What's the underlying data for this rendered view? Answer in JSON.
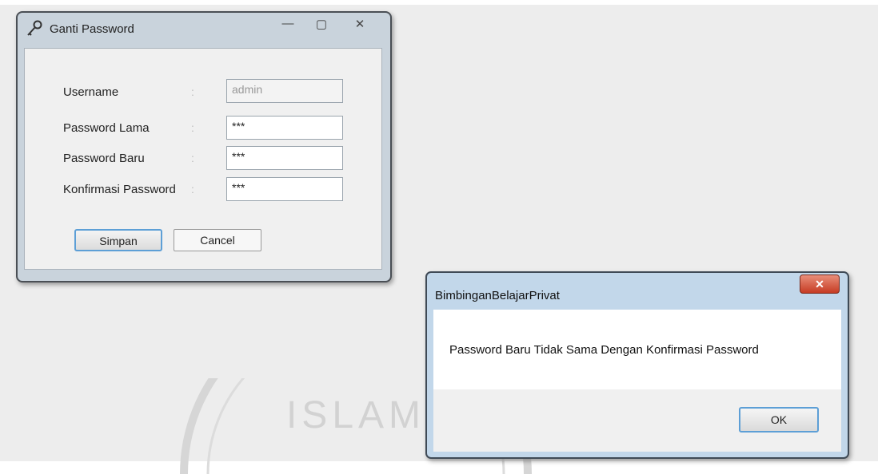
{
  "ganti_password_window": {
    "title": "Ganti Password",
    "controls": {
      "minimize": "—",
      "maximize": "▢",
      "close": "✕"
    },
    "form": {
      "username_label": "Username",
      "username_value": "admin",
      "old_password_label": "Password Lama",
      "old_password_value": "***",
      "new_password_label": "Password Baru",
      "new_password_value": "***",
      "confirm_password_label": "Konfirmasi Password",
      "confirm_password_value": "***",
      "colon": ":"
    },
    "buttons": {
      "save": "Simpan",
      "cancel": "Cancel"
    }
  },
  "message_box": {
    "title": "BimbinganBelajarPrivat",
    "close": "✕",
    "message": "Password Baru Tidak Sama Dengan Konfirmasi Password",
    "ok": "OK"
  },
  "watermark": {
    "text": "ISLAM"
  },
  "colors": {
    "background": "#ededed",
    "window_frame": "#c9d3dc",
    "dialog_frame": "#c2d7ea",
    "focus_border": "#5d9fd6",
    "close_red": "#c63b23"
  }
}
